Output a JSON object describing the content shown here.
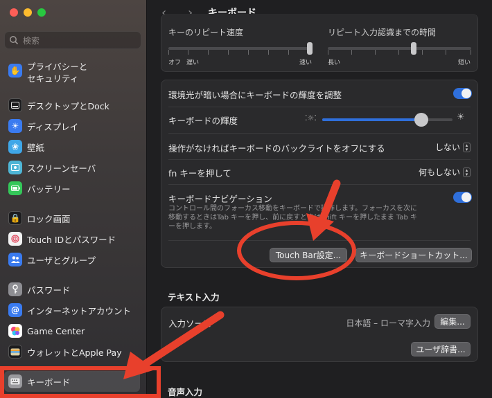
{
  "sidebar": {
    "search_placeholder": "検索",
    "items": [
      {
        "label": "プライバシーと",
        "label2": "セキュリティ",
        "icon": "hand-icon",
        "color": "#3a7bf0"
      },
      {
        "label": "デスクトップとDock",
        "icon": "dock-icon",
        "color": "#1c1c1e"
      },
      {
        "label": "ディスプレイ",
        "icon": "sun-icon",
        "color": "#3a7bf0"
      },
      {
        "label": "壁紙",
        "icon": "flower-icon",
        "color": "#3fa7e8"
      },
      {
        "label": "スクリーンセーバ",
        "icon": "screensaver-icon",
        "color": "#4fb6d6"
      },
      {
        "label": "バッテリー",
        "icon": "battery-icon",
        "color": "#34c759"
      },
      {
        "label": "ロック画面",
        "icon": "lock-icon",
        "color": "#1c1c1e"
      },
      {
        "label": "Touch IDとパスワード",
        "icon": "fingerprint-icon",
        "color": "#f2f2f2"
      },
      {
        "label": "ユーザとグループ",
        "icon": "users-icon",
        "color": "#3a7bf0"
      },
      {
        "label": "パスワード",
        "icon": "key-icon",
        "color": "#8e8e93"
      },
      {
        "label": "インターネットアカウント",
        "icon": "at-icon",
        "color": "#3a7bf0"
      },
      {
        "label": "Game Center",
        "icon": "gamecenter-icon",
        "color": "#ffffff"
      },
      {
        "label": "ウォレットとApple Pay",
        "icon": "wallet-icon",
        "color": "#1c1c1e"
      },
      {
        "label": "キーボード",
        "icon": "keyboard-icon",
        "color": "#9a9a9e"
      }
    ]
  },
  "header": {
    "back_label": "‹",
    "forward_label": "›",
    "title": "キーボード"
  },
  "repeat": {
    "label_a": "キーのリピート速度",
    "label_b": "リピート入力認識までの時間",
    "a_min": "オフ",
    "a_slow": "遅い",
    "a_fast": "速い",
    "b_long": "長い",
    "b_short": "短い"
  },
  "keyboard_settings": {
    "ambient_label": "環境光が暗い場合にキーボードの輝度を調整",
    "ambient_on": true,
    "brightness_label": "キーボードの輝度",
    "brightness_level": 0.76,
    "backlight_label": "操作がなければキーボードのバックライトをオフにする",
    "backlight_value": "しない",
    "fn_label": "fn キーを押して",
    "fn_value": "何もしない",
    "nav_label": "キーボードナビゲーション",
    "nav_on": true,
    "nav_hint": "コントロール間のフォーカス移動をキーボードで操作します。フォーカスを次に移動するときはTab キーを押し、前に戻すときはShift キーを押したまま Tab キーを押します。",
    "touchbar_button": "Touch Bar設定...",
    "shortcut_button": "キーボードショートカット..."
  },
  "text_input": {
    "section_title": "テキスト入力",
    "source_label": "入力ソース",
    "source_value": "日本語 – ローマ字入力",
    "edit_button": "編集...",
    "dictionary_button": "ユーザ辞書..."
  },
  "voice_input": {
    "section_title": "音声入力"
  },
  "annotations": {
    "color": "#e8402c"
  }
}
